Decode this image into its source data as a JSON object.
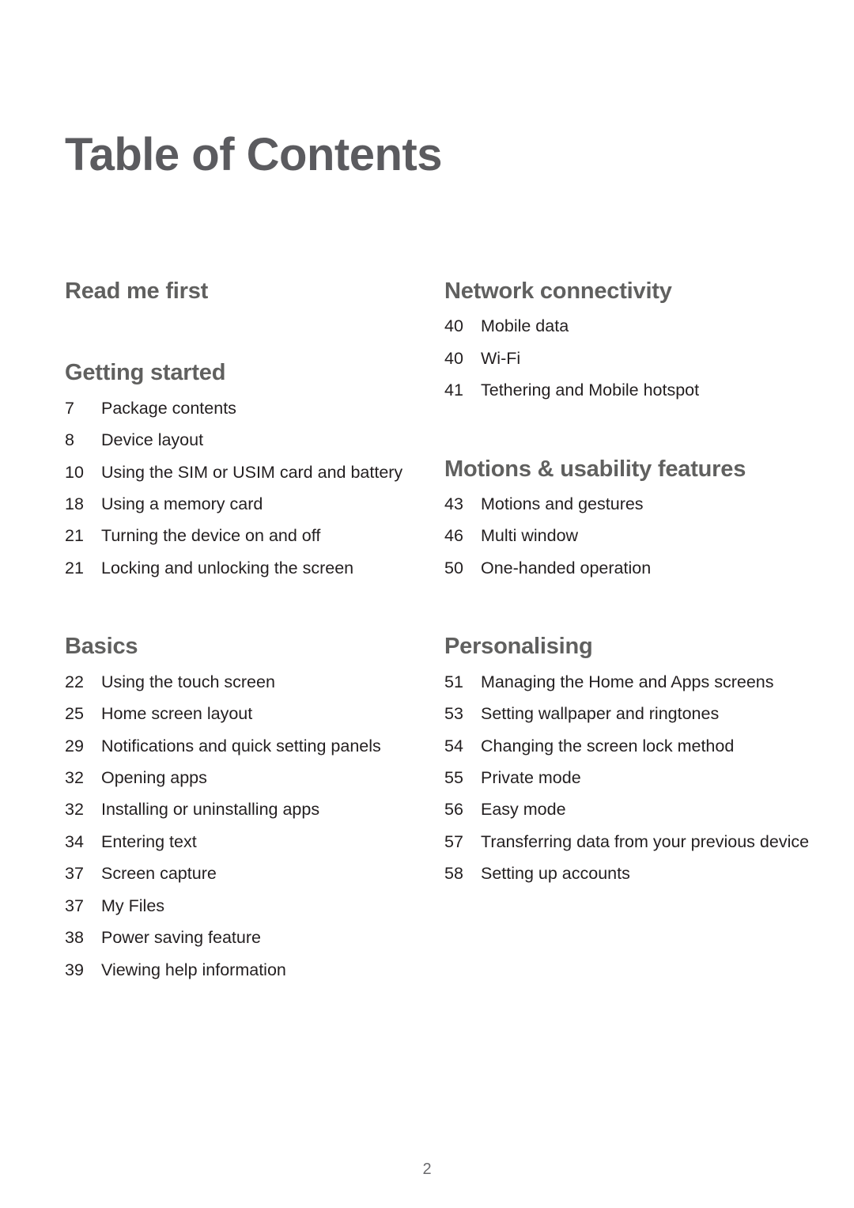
{
  "document": {
    "title": "Table of Contents",
    "page_number": "2"
  },
  "columns": {
    "left": [
      {
        "heading": "Read me first",
        "entries": []
      },
      {
        "heading": "Getting started",
        "entries": [
          {
            "page": "7",
            "title": "Package contents"
          },
          {
            "page": "8",
            "title": "Device layout"
          },
          {
            "page": "10",
            "title": "Using the SIM or USIM card and battery"
          },
          {
            "page": "18",
            "title": "Using a memory card"
          },
          {
            "page": "21",
            "title": "Turning the device on and off"
          },
          {
            "page": "21",
            "title": "Locking and unlocking the screen"
          }
        ]
      },
      {
        "heading": "Basics",
        "entries": [
          {
            "page": "22",
            "title": "Using the touch screen"
          },
          {
            "page": "25",
            "title": "Home screen layout"
          },
          {
            "page": "29",
            "title": "Notifications and quick setting panels"
          },
          {
            "page": "32",
            "title": "Opening apps"
          },
          {
            "page": "32",
            "title": "Installing or uninstalling apps"
          },
          {
            "page": "34",
            "title": "Entering text"
          },
          {
            "page": "37",
            "title": "Screen capture"
          },
          {
            "page": "37",
            "title": "My Files"
          },
          {
            "page": "38",
            "title": "Power saving feature"
          },
          {
            "page": "39",
            "title": "Viewing help information"
          }
        ]
      }
    ],
    "right": [
      {
        "heading": "Network connectivity",
        "entries": [
          {
            "page": "40",
            "title": "Mobile data"
          },
          {
            "page": "40",
            "title": "Wi-Fi"
          },
          {
            "page": "41",
            "title": "Tethering and Mobile hotspot"
          }
        ]
      },
      {
        "heading": "Motions & usability features",
        "entries": [
          {
            "page": "43",
            "title": "Motions and gestures"
          },
          {
            "page": "46",
            "title": "Multi window"
          },
          {
            "page": "50",
            "title": "One-handed operation"
          }
        ]
      },
      {
        "heading": "Personalising",
        "entries": [
          {
            "page": "51",
            "title": "Managing the Home and Apps screens"
          },
          {
            "page": "53",
            "title": "Setting wallpaper and ringtones"
          },
          {
            "page": "54",
            "title": "Changing the screen lock method"
          },
          {
            "page": "55",
            "title": "Private mode"
          },
          {
            "page": "56",
            "title": "Easy mode"
          },
          {
            "page": "57",
            "title": "Transferring data from your previous device"
          },
          {
            "page": "58",
            "title": "Setting up accounts"
          }
        ]
      }
    ]
  },
  "colors": {
    "heading": "#60605f",
    "body": "#231f20",
    "page_number": "#6a6a6d",
    "background": "#ffffff"
  }
}
